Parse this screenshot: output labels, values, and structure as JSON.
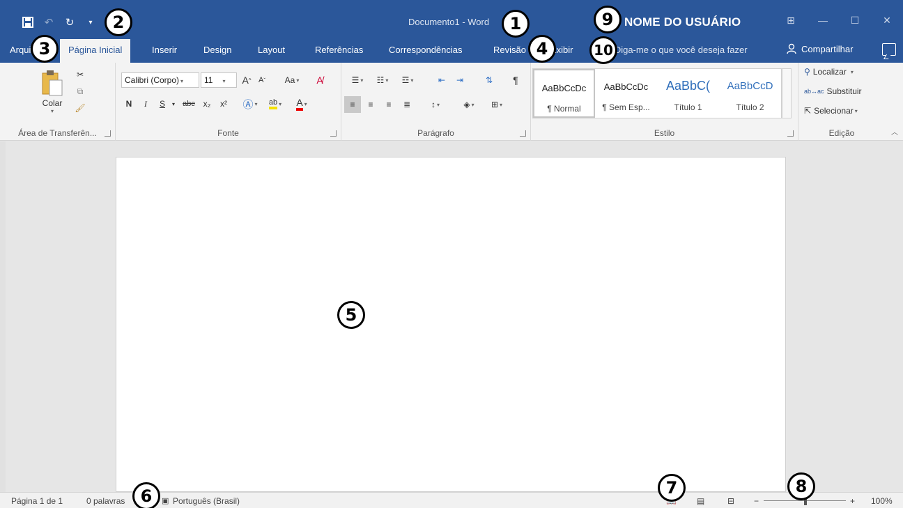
{
  "title_bar": {
    "document_title": "Documento1 - Word",
    "user_name": "NOME DO USUÁRIO",
    "qat_icons": [
      "save-icon",
      "undo-icon",
      "redo-icon",
      "customize-qat-icon"
    ],
    "window_controls": [
      "ribbon-display-icon",
      "minimize-icon",
      "maximize-icon",
      "close-icon"
    ],
    "ribbon_display_glyph": "⊞",
    "minimize_glyph": "—",
    "maximize_glyph": "☐",
    "close_glyph": "✕"
  },
  "tabs": [
    "Arquivo",
    "Página Inicial",
    "Inserir",
    "Design",
    "Layout",
    "Referências",
    "Correspondências",
    "Revisão",
    "Exibir"
  ],
  "active_tab": "Página Inicial",
  "tell_me": "Diga-me o que você deseja fazer",
  "share_label": "Compartilhar",
  "ribbon": {
    "clipboard": {
      "label": "Área de Transferên...",
      "paste": "Colar"
    },
    "font": {
      "label": "Fonte",
      "font_name": "Calibri (Corpo)",
      "font_size": "11",
      "change_case": "Aa",
      "bold": "N",
      "italic": "I",
      "underline": "S",
      "strike": "abc",
      "subscript": "x₂",
      "superscript": "x²"
    },
    "paragraph": {
      "label": "Parágrafo",
      "pilcrow": "¶"
    },
    "styles": {
      "label": "Estilo",
      "items": [
        {
          "preview": "AaBbCcDc",
          "name": "¶ Normal"
        },
        {
          "preview": "AaBbCcDc",
          "name": "¶ Sem Esp..."
        },
        {
          "preview": "AaBbC(",
          "name": "Título 1"
        },
        {
          "preview": "AaBbCcD",
          "name": "Título 2"
        }
      ]
    },
    "editing": {
      "label": "Edição",
      "find": "Localizar",
      "replace": "Substituir",
      "select": "Selecionar"
    }
  },
  "status_bar": {
    "page": "Página 1 de 1",
    "words": "0 palavras",
    "language": "Português (Brasil)",
    "zoom": "100%",
    "zoom_percent": 100
  },
  "callouts": [
    "1",
    "2",
    "3",
    "4",
    "5",
    "6",
    "7",
    "8",
    "9",
    "10"
  ],
  "colors": {
    "accent": "#2b579a",
    "ribbon_bg": "#f3f3f3",
    "doc_bg": "#e6e6e6"
  }
}
